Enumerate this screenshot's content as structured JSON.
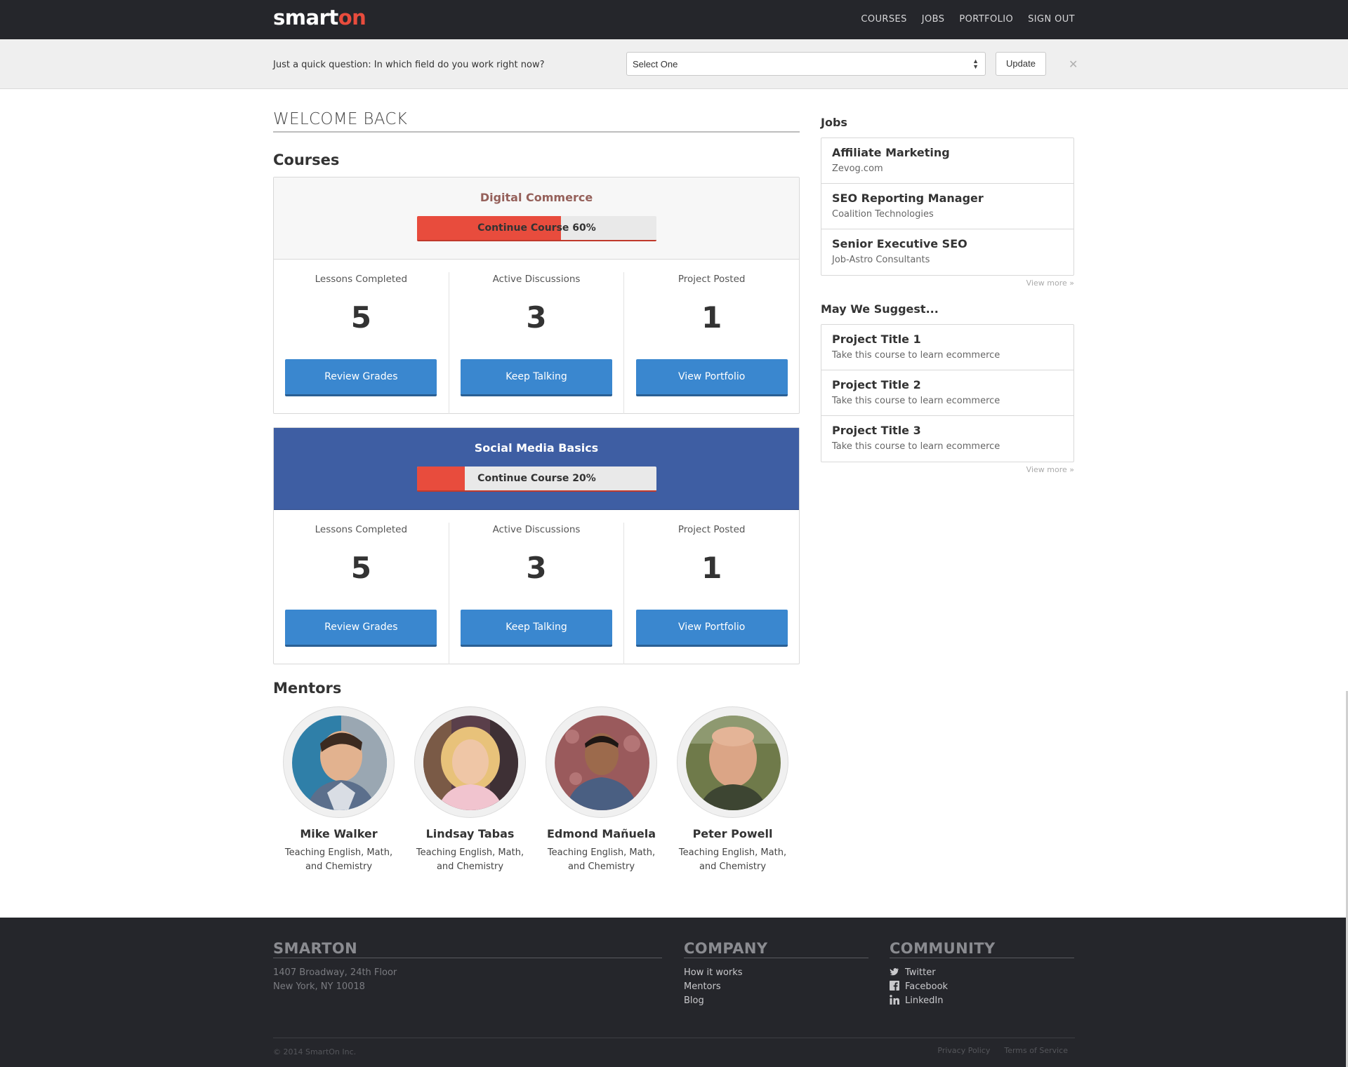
{
  "nav": {
    "logo_main": "smart",
    "logo_accent": "on",
    "links": [
      "COURSES",
      "JOBS",
      "PORTFOLIO",
      "SIGN OUT"
    ]
  },
  "question": {
    "text": "Just a quick question: In which field do you work right now?",
    "select_value": "Select One",
    "update_label": "Update",
    "close_glyph": "✕"
  },
  "welcome": "WELCOME BACK",
  "courses_title": "Courses",
  "courses": [
    {
      "title": "Digital Commerce",
      "progress_label": "Continue Course 60%",
      "progress_percent": 60,
      "stats": [
        {
          "label": "Lessons Completed",
          "value": "5",
          "button": "Review Grades"
        },
        {
          "label": "Active Discussions",
          "value": "3",
          "button": "Keep Talking"
        },
        {
          "label": "Project Posted",
          "value": "1",
          "button": "View Portfolio"
        }
      ]
    },
    {
      "title": "Social Media Basics",
      "progress_label": "Continue Course 20%",
      "progress_percent": 20,
      "stats": [
        {
          "label": "Lessons Completed",
          "value": "5",
          "button": "Review Grades"
        },
        {
          "label": "Active Discussions",
          "value": "3",
          "button": "Keep Talking"
        },
        {
          "label": "Project Posted",
          "value": "1",
          "button": "View Portfolio"
        }
      ]
    }
  ],
  "mentors_title": "Mentors",
  "mentors": [
    {
      "name": "Mike Walker",
      "desc_1": "Teaching English, Math,",
      "desc_2": "and Chemistry"
    },
    {
      "name": "Lindsay Tabas",
      "desc_1": "Teaching English, Math,",
      "desc_2": "and Chemistry"
    },
    {
      "name": "Edmond Mañuela",
      "desc_1": "Teaching English, Math,",
      "desc_2": "and Chemistry"
    },
    {
      "name": "Peter Powell",
      "desc_1": "Teaching English, Math,",
      "desc_2": "and Chemistry"
    }
  ],
  "jobs": {
    "title": "Jobs",
    "items": [
      {
        "title": "Affiliate Marketing",
        "sub": "Zevog.com"
      },
      {
        "title": "SEO Reporting Manager",
        "sub": "Coalition Technologies"
      },
      {
        "title": "Senior Executive SEO",
        "sub": "Job-Astro Consultants"
      }
    ],
    "view_more": "View more »"
  },
  "suggest": {
    "title": "May We Suggest...",
    "items": [
      {
        "title": "Project Title 1",
        "sub": "Take this course to learn ecommerce"
      },
      {
        "title": "Project Title 2",
        "sub": "Take this course to learn ecommerce"
      },
      {
        "title": "Project Title 3",
        "sub": "Take this course to learn ecommerce"
      }
    ],
    "view_more": "View more »"
  },
  "footer": {
    "smarton_head": "SMARTON",
    "address_1": "1407 Broadway, 24th Floor",
    "address_2": "New York, NY 10018",
    "company_head": "COMPANY",
    "company_links": [
      "How it works",
      "Mentors",
      "Blog"
    ],
    "community_head": "COMMUNITY",
    "community_links": [
      "Twitter",
      "Facebook",
      "LinkedIn"
    ],
    "copyright": "© 2014 SmartOn Inc.",
    "privacy": "Privacy Policy",
    "terms": "Terms of Service"
  },
  "colors": {
    "brand_accent": "#e84c3d",
    "button_blue": "#3a87cf",
    "course_blue": "#3e5ea3",
    "dark": "#25262b"
  }
}
